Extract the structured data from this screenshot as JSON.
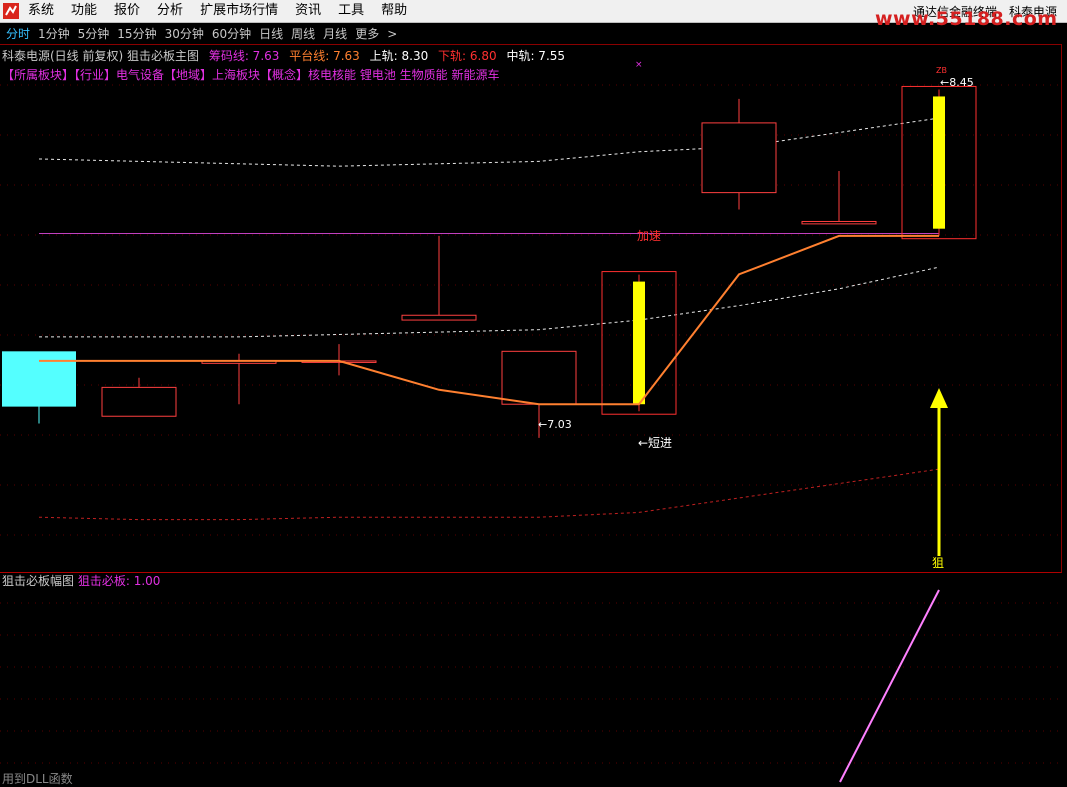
{
  "menubar": {
    "items": [
      "系统",
      "功能",
      "报价",
      "分析",
      "扩展市场行情",
      "资讯",
      "工具",
      "帮助"
    ],
    "terminal_name": "通达信金融终端",
    "stock_name": "科泰电源",
    "watermark": "www.55188.com"
  },
  "periods": {
    "tabs": [
      "分时",
      "1分钟",
      "5分钟",
      "15分钟",
      "30分钟",
      "60分钟",
      "日线",
      "周线",
      "月线",
      "更多",
      ">"
    ],
    "active": "分时"
  },
  "main_info": {
    "title": "科泰电源(日线 前复权) 狙击必板主图",
    "chip_line": "筹码线: 7.63",
    "platform_line": "平台线: 7.63",
    "upper_rail": "上轨: 8.30",
    "lower_rail": "下轨: 6.80",
    "mid_rail": "中轨: 7.55",
    "colors": {
      "title": "#c8c8c8",
      "chip": "#e030e0",
      "platform": "#ff8030",
      "upper": "#ffffff",
      "lower": "#ff3030",
      "mid": "#ffffff"
    }
  },
  "sector_info": "【所属板块】【行业】电气设备【地域】上海板块【概念】核电核能 锂电池 生物质能 新能源车",
  "sub_info": {
    "title": "狙击必板幅图",
    "value": "狙击必板: 1.00"
  },
  "status_hint": "用到DLL函数",
  "annotations": {
    "accelerate": "加速",
    "short_entry": "←短进",
    "low_price": "←7.03",
    "high_price": "←8.45",
    "board_tag": "ZB",
    "buy_marker": "狙",
    "top_marker": "×"
  },
  "chart_data": [
    {
      "type": "candlestick",
      "title": "科泰电源(日线 前复权) 狙击必板主图",
      "candles": [
        {
          "open": 7.39,
          "close": 7.16,
          "high": 7.22,
          "low": 7.09
        },
        {
          "open": 7.12,
          "close": 7.24,
          "high": 7.28,
          "low": 7.12
        },
        {
          "open": 7.34,
          "close": 7.35,
          "high": 7.38,
          "low": 7.17
        },
        {
          "open": 7.35,
          "close": 7.35,
          "high": 7.42,
          "low": 7.29
        },
        {
          "open": 7.52,
          "close": 7.54,
          "high": 7.87,
          "low": 7.52
        },
        {
          "open": 7.17,
          "close": 7.39,
          "high": 7.39,
          "low": 7.03
        },
        {
          "open": 7.17,
          "close": 7.68,
          "high": 7.68,
          "low": 7.17
        },
        {
          "open": 8.05,
          "close": 8.34,
          "high": 8.44,
          "low": 7.98
        },
        {
          "open": 7.92,
          "close": 7.93,
          "high": 8.14,
          "low": 7.92
        },
        {
          "open": 7.9,
          "close": 8.45,
          "high": 8.45,
          "low": 7.9
        }
      ],
      "platform_line": [
        7.35,
        7.35,
        7.35,
        7.35,
        7.23,
        7.17,
        7.17,
        7.71,
        7.87,
        7.87
      ],
      "upper_band": [
        8.19,
        8.18,
        8.17,
        8.16,
        8.17,
        8.18,
        8.22,
        8.24,
        8.3,
        8.36
      ],
      "mid_band": [
        7.45,
        7.45,
        7.45,
        7.46,
        7.47,
        7.48,
        7.52,
        7.58,
        7.65,
        7.74
      ],
      "lower_band": [
        6.7,
        6.69,
        6.69,
        6.7,
        6.7,
        6.7,
        6.72,
        6.78,
        6.84,
        6.9
      ],
      "signal_candles": [
        6,
        9
      ],
      "reference_line": 7.88,
      "grid": true
    },
    {
      "type": "line",
      "title": "狙击必板幅图",
      "series": [
        {
          "name": "狙击必板",
          "values": [
            0,
            1.0
          ]
        }
      ],
      "grid": true
    }
  ]
}
